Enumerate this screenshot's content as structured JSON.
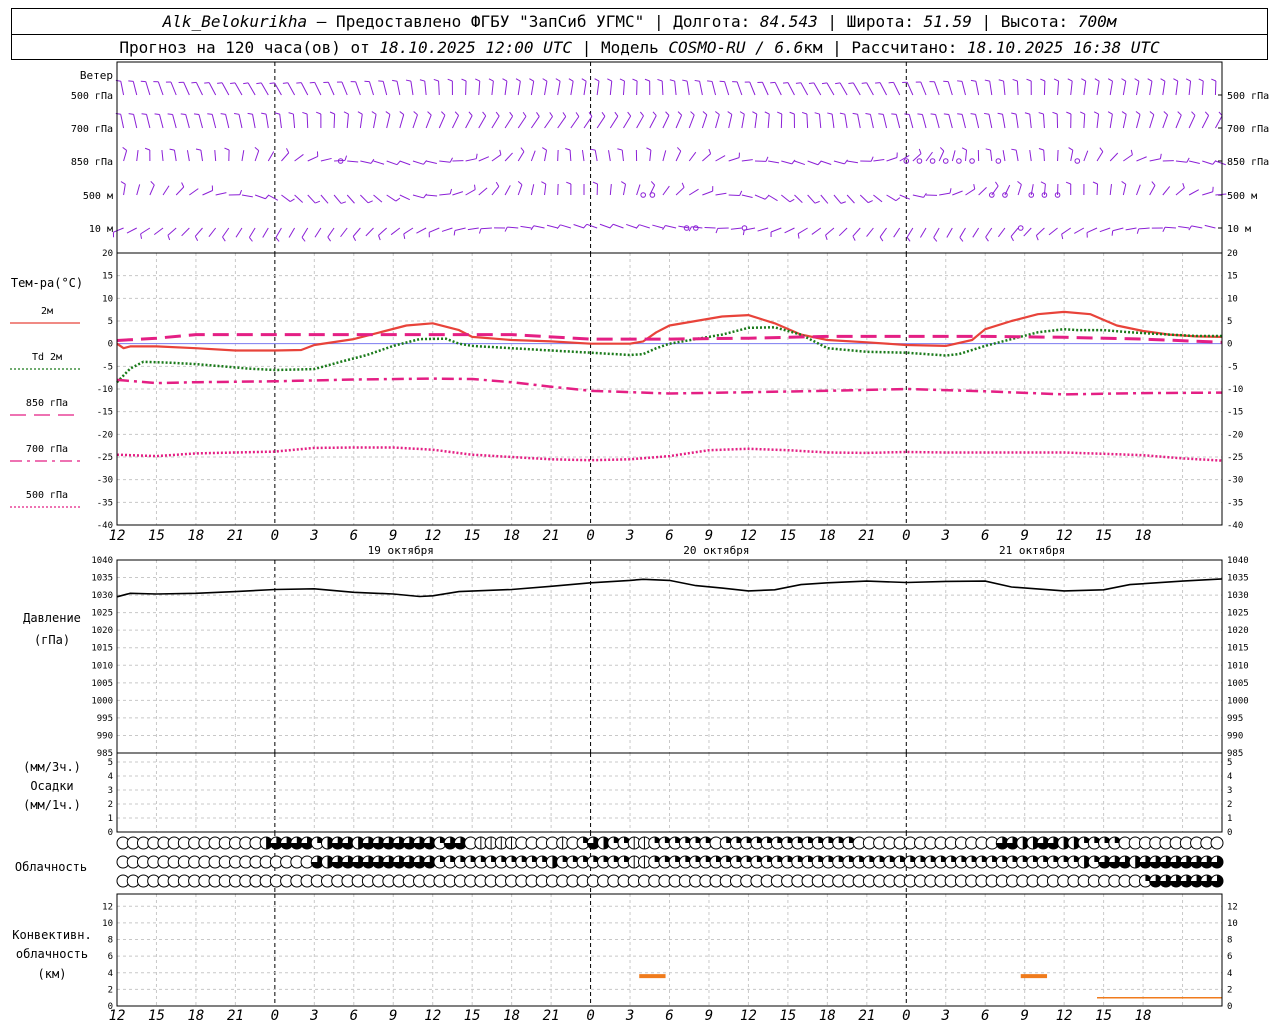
{
  "header": {
    "line1": {
      "station": "Alk_Belokurikha",
      "provider": " – Предоставлено ФГБУ \"ЗапСиб УГМС\" | Долгота: ",
      "lon": "84.543",
      "lat_label": " | Широта: ",
      "lat": "51.59",
      "alt_label": " | Высота: ",
      "alt": "700м"
    },
    "line2": {
      "forecast_label": "Прогноз на 120 часа(ов) от ",
      "start": "18.10.2025 12:00 UTC",
      "model_label": "  | Модель ",
      "model": "COSMO-RU / 6.6",
      "model_unit": "км",
      "calc_label": " | Рассчитано: ",
      "calc": "18.10.2025 16:38 UTC"
    }
  },
  "chart_data": {
    "type": "line",
    "time_axis": {
      "start": "18.10.2025 12:00 UTC",
      "step_hours": 3,
      "tick_labels": [
        "12",
        "15",
        "18",
        "21",
        "0",
        "3",
        "6",
        "9",
        "12",
        "15",
        "18",
        "21",
        "0",
        "3",
        "6",
        "9",
        "12",
        "15",
        "18",
        "21",
        "0",
        "3",
        "6",
        "9",
        "12",
        "15",
        "18"
      ],
      "date_labels": [
        {
          "hour": 12,
          "text": "19 октября"
        },
        {
          "hour": 36,
          "text": "20 октября"
        },
        {
          "hour": 60,
          "text": "21 октября"
        }
      ]
    },
    "wind_panel": {
      "title": "Ветер",
      "levels": [
        "500 гПа",
        "700 гПа",
        "850 гПа",
        "500 м",
        "10  м"
      ],
      "calm_markers": [
        {
          "level": 2,
          "hours": [
            17,
            60,
            61,
            62,
            63,
            64,
            65,
            67,
            73
          ]
        },
        {
          "level": 3,
          "hours": [
            40,
            40.7,
            66.5,
            67.5,
            69.5,
            70.5,
            71.5
          ]
        },
        {
          "level": 4,
          "hours": [
            43.3,
            44,
            47.7,
            68.7
          ]
        }
      ],
      "color": "#8b1fd6"
    },
    "temperature_panel": {
      "ylabel": "Тем-ра(°С)",
      "ylim": [
        -40,
        20
      ],
      "yticks": [
        20,
        15,
        10,
        5,
        0,
        -5,
        -10,
        -15,
        -20,
        -25,
        -30,
        -35,
        -40
      ],
      "series": [
        {
          "name": "2м",
          "color": "#e8433a",
          "style": "solid",
          "points": [
            [
              0,
              0
            ],
            [
              0.5,
              -1
            ],
            [
              1,
              -0.6
            ],
            [
              3,
              -0.6
            ],
            [
              6,
              -1
            ],
            [
              9,
              -1.5
            ],
            [
              12,
              -1.5
            ],
            [
              14,
              -1.4
            ],
            [
              15,
              -0.3
            ],
            [
              18,
              1
            ],
            [
              20,
              2.5
            ],
            [
              22,
              4
            ],
            [
              24,
              4.5
            ],
            [
              26,
              3
            ],
            [
              27,
              1.5
            ],
            [
              30,
              0.8
            ],
            [
              33,
              0.5
            ],
            [
              36,
              0
            ],
            [
              39,
              0
            ],
            [
              40,
              0.5
            ],
            [
              41,
              2.5
            ],
            [
              42,
              4
            ],
            [
              44,
              5
            ],
            [
              46,
              6
            ],
            [
              48,
              6.3
            ],
            [
              50,
              4.5
            ],
            [
              52,
              2
            ],
            [
              54,
              0.8
            ],
            [
              57,
              0.3
            ],
            [
              60,
              -0.3
            ],
            [
              63,
              -0.5
            ],
            [
              65,
              0.8
            ],
            [
              66,
              3.2
            ],
            [
              68,
              5
            ],
            [
              70,
              6.5
            ],
            [
              72,
              7
            ],
            [
              74,
              6.5
            ],
            [
              76,
              4
            ],
            [
              78,
              2.8
            ],
            [
              80,
              2
            ],
            [
              82,
              1.6
            ],
            [
              84,
              1.5
            ]
          ]
        },
        {
          "name": "Td  2м",
          "color": "#1a7a1a",
          "style": "dotted",
          "points": [
            [
              0,
              -8.5
            ],
            [
              1,
              -5.5
            ],
            [
              2,
              -4
            ],
            [
              4,
              -4.2
            ],
            [
              6,
              -4.5
            ],
            [
              8,
              -5
            ],
            [
              10,
              -5.5
            ],
            [
              12,
              -5.8
            ],
            [
              15,
              -5.6
            ],
            [
              17,
              -4
            ],
            [
              19,
              -2.5
            ],
            [
              21,
              -0.5
            ],
            [
              23,
              1
            ],
            [
              25,
              1.1
            ],
            [
              26,
              0
            ],
            [
              27,
              -0.5
            ],
            [
              30,
              -1
            ],
            [
              33,
              -1.5
            ],
            [
              36,
              -2
            ],
            [
              39,
              -2.5
            ],
            [
              40,
              -2.3
            ],
            [
              41,
              -1
            ],
            [
              42,
              0
            ],
            [
              44,
              1
            ],
            [
              46,
              2
            ],
            [
              48,
              3.5
            ],
            [
              50,
              3.6
            ],
            [
              52,
              2
            ],
            [
              54,
              -1
            ],
            [
              57,
              -1.8
            ],
            [
              60,
              -2
            ],
            [
              63,
              -2.6
            ],
            [
              64,
              -2.3
            ],
            [
              66,
              -0.5
            ],
            [
              68,
              1
            ],
            [
              70,
              2.5
            ],
            [
              72,
              3.2
            ],
            [
              73,
              3
            ],
            [
              75,
              3
            ],
            [
              77,
              2.5
            ],
            [
              80,
              2
            ],
            [
              82,
              1.7
            ],
            [
              84,
              1.7
            ]
          ]
        },
        {
          "name": "850 гПа",
          "color": "#e41f84",
          "style": "dashed-long",
          "points": [
            [
              0,
              0.7
            ],
            [
              3,
              1.2
            ],
            [
              6,
              2
            ],
            [
              12,
              2
            ],
            [
              18,
              2
            ],
            [
              24,
              2
            ],
            [
              30,
              2
            ],
            [
              36,
              1
            ],
            [
              40,
              1
            ],
            [
              42,
              1
            ],
            [
              48,
              1.2
            ],
            [
              54,
              1.6
            ],
            [
              60,
              1.6
            ],
            [
              66,
              1.6
            ],
            [
              72,
              1.4
            ],
            [
              78,
              1
            ],
            [
              84,
              0.3
            ]
          ]
        },
        {
          "name": "700 гПа",
          "color": "#e41f84",
          "style": "dashdot",
          "points": [
            [
              0,
              -8
            ],
            [
              3,
              -8.7
            ],
            [
              6,
              -8.5
            ],
            [
              12,
              -8.3
            ],
            [
              18,
              -7.9
            ],
            [
              24,
              -7.7
            ],
            [
              27,
              -7.8
            ],
            [
              30,
              -8.5
            ],
            [
              33,
              -9.5
            ],
            [
              36,
              -10.4
            ],
            [
              42,
              -11
            ],
            [
              48,
              -10.7
            ],
            [
              54,
              -10.4
            ],
            [
              60,
              -10
            ],
            [
              66,
              -10.5
            ],
            [
              72,
              -11.2
            ],
            [
              78,
              -10.9
            ],
            [
              84,
              -10.8
            ]
          ]
        },
        {
          "name": "500 гПа",
          "color": "#e41f84",
          "style": "dotted",
          "points": [
            [
              0,
              -24.5
            ],
            [
              3,
              -24.8
            ],
            [
              6,
              -24.2
            ],
            [
              9,
              -24
            ],
            [
              12,
              -23.8
            ],
            [
              15,
              -23
            ],
            [
              18,
              -22.9
            ],
            [
              21,
              -22.9
            ],
            [
              24,
              -23.4
            ],
            [
              27,
              -24.5
            ],
            [
              30,
              -25
            ],
            [
              33,
              -25.5
            ],
            [
              36,
              -25.7
            ],
            [
              39,
              -25.5
            ],
            [
              42,
              -24.8
            ],
            [
              45,
              -23.5
            ],
            [
              48,
              -23.2
            ],
            [
              51,
              -23.5
            ],
            [
              54,
              -24
            ],
            [
              57,
              -24.1
            ],
            [
              60,
              -23.9
            ],
            [
              63,
              -24
            ],
            [
              66,
              -24
            ],
            [
              69,
              -24
            ],
            [
              72,
              -24
            ],
            [
              75,
              -24.3
            ],
            [
              78,
              -24.6
            ],
            [
              81,
              -25.3
            ],
            [
              84,
              -25.8
            ]
          ]
        }
      ]
    },
    "pressure_panel": {
      "ylabel": "Давление",
      "unit": "(гПа)",
      "ylim": [
        985,
        1040
      ],
      "yticks": [
        1040,
        1035,
        1030,
        1025,
        1020,
        1015,
        1010,
        1005,
        1000,
        995,
        990,
        985
      ],
      "series": [
        {
          "name": "pressure",
          "color": "#000000",
          "points": [
            [
              0,
              1029.5
            ],
            [
              1,
              1030.5
            ],
            [
              3,
              1030.3
            ],
            [
              6,
              1030.5
            ],
            [
              9,
              1031
            ],
            [
              12,
              1031.6
            ],
            [
              15,
              1031.8
            ],
            [
              18,
              1030.8
            ],
            [
              21,
              1030.3
            ],
            [
              23,
              1029.6
            ],
            [
              24,
              1029.8
            ],
            [
              26,
              1031
            ],
            [
              30,
              1031.6
            ],
            [
              33,
              1032.5
            ],
            [
              36,
              1033.5
            ],
            [
              39,
              1034.2
            ],
            [
              40,
              1034.5
            ],
            [
              42,
              1034.2
            ],
            [
              44,
              1032.7
            ],
            [
              46,
              1032
            ],
            [
              48,
              1031.2
            ],
            [
              50,
              1031.5
            ],
            [
              52,
              1033
            ],
            [
              54,
              1033.5
            ],
            [
              57,
              1034
            ],
            [
              60,
              1033.6
            ],
            [
              63,
              1033.9
            ],
            [
              66,
              1034
            ],
            [
              68,
              1032.3
            ],
            [
              72,
              1031.2
            ],
            [
              75,
              1031.5
            ],
            [
              77,
              1033
            ],
            [
              81,
              1034
            ],
            [
              84,
              1034.6
            ]
          ]
        }
      ]
    },
    "precip_panel": {
      "label_top": "(мм/3ч.)",
      "label_mid": "Осадки",
      "label_bot": "(мм/1ч.)",
      "ylim": [
        0,
        5
      ],
      "yticks": [
        5,
        4,
        3,
        2,
        1,
        0
      ],
      "values": []
    },
    "cloud_panel": {
      "label": "Облачность",
      "rows": [
        "000000000000003444423443444444424401111000010243221122222202222222222222000000000000004433443322220000000000",
        "000000000000000000043444444444422222222222322222221122222222222222222222222222222222222222222232444344444444",
        "000000000000000000000000000000000000000000000000000000000000000000000000000000000000000000000000000024444444"
      ]
    },
    "convective_panel": {
      "label_top": "Конвективн.",
      "label_mid": "облачность",
      "label_unit": "(км)",
      "ylim": [
        0,
        13
      ],
      "yticks": [
        12,
        10,
        8,
        6,
        4,
        2,
        0
      ],
      "segments": [
        {
          "from_h": 39.7,
          "to_h": 41.7,
          "km": 3.6,
          "color": "#f07b1c",
          "thick": true
        },
        {
          "from_h": 68.7,
          "to_h": 70.7,
          "km": 3.6,
          "color": "#f07b1c",
          "thick": true
        },
        {
          "from_h": 74.5,
          "to_h": 84,
          "km": 1,
          "color": "#f07b1c",
          "thick": false
        }
      ]
    }
  }
}
